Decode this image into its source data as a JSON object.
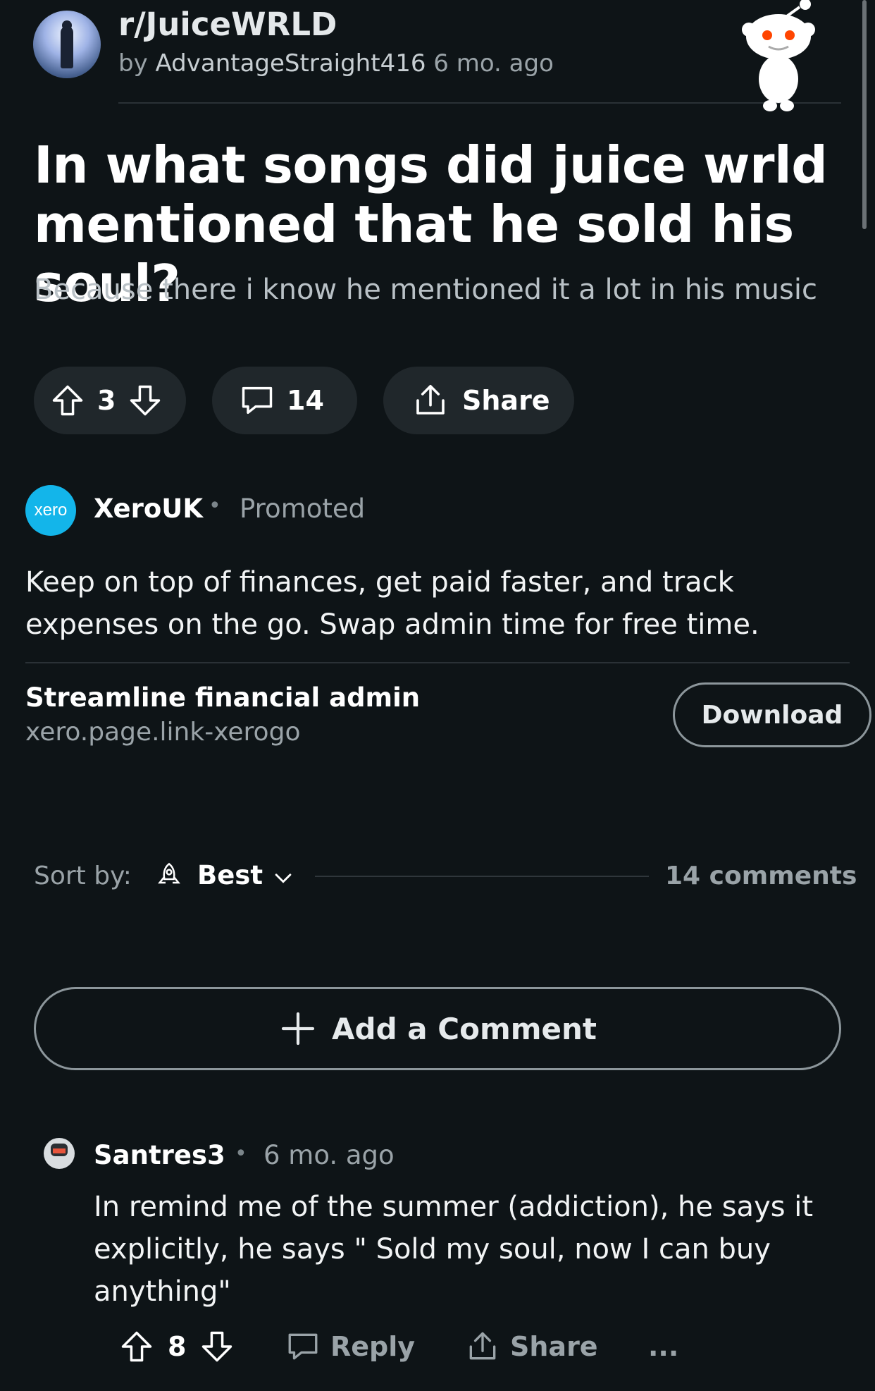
{
  "post": {
    "subreddit": "r/JuiceWRLD",
    "author_prefix": "by",
    "author": "AdvantageStraight416",
    "time": "6 mo. ago",
    "title": "In what songs did juice wrld mentioned that he sold his soul?",
    "body": "Because there i know he mentioned it a lot in his music",
    "votes": "3",
    "comments": "14",
    "share_label": "Share"
  },
  "ad": {
    "logo_text": "xero",
    "advertiser": "XeroUK",
    "separator": "•",
    "promoted_label": "Promoted",
    "text": "Keep on top of finances, get paid faster, and track expenses on the go. Swap admin time for free time.",
    "headline": "Streamline financial admin",
    "url": "xero.page.link-xerogo",
    "cta": "Download"
  },
  "sort": {
    "label": "Sort by:",
    "value": "Best",
    "count_text": "14 comments"
  },
  "add_comment_label": "Add a Comment",
  "comment": {
    "user": "Santres3",
    "separator": "•",
    "time": "6 mo. ago",
    "text": "In remind me of the summer (addiction), he says it explicitly, he says \" Sold my soul, now I can buy anything\"",
    "votes": "8",
    "reply_label": "Reply",
    "share_label": "Share",
    "more_label": "..."
  },
  "colors": {
    "background": "#0e1417",
    "pill": "#20272b",
    "muted_text": "#9aa3a8",
    "xero_brand": "#13b5ea"
  },
  "icons": [
    "upvote-icon",
    "downvote-icon",
    "comment-icon",
    "share-icon",
    "rocket-icon",
    "chevron-down-icon",
    "plus-icon",
    "reply-icon",
    "more-icon"
  ]
}
